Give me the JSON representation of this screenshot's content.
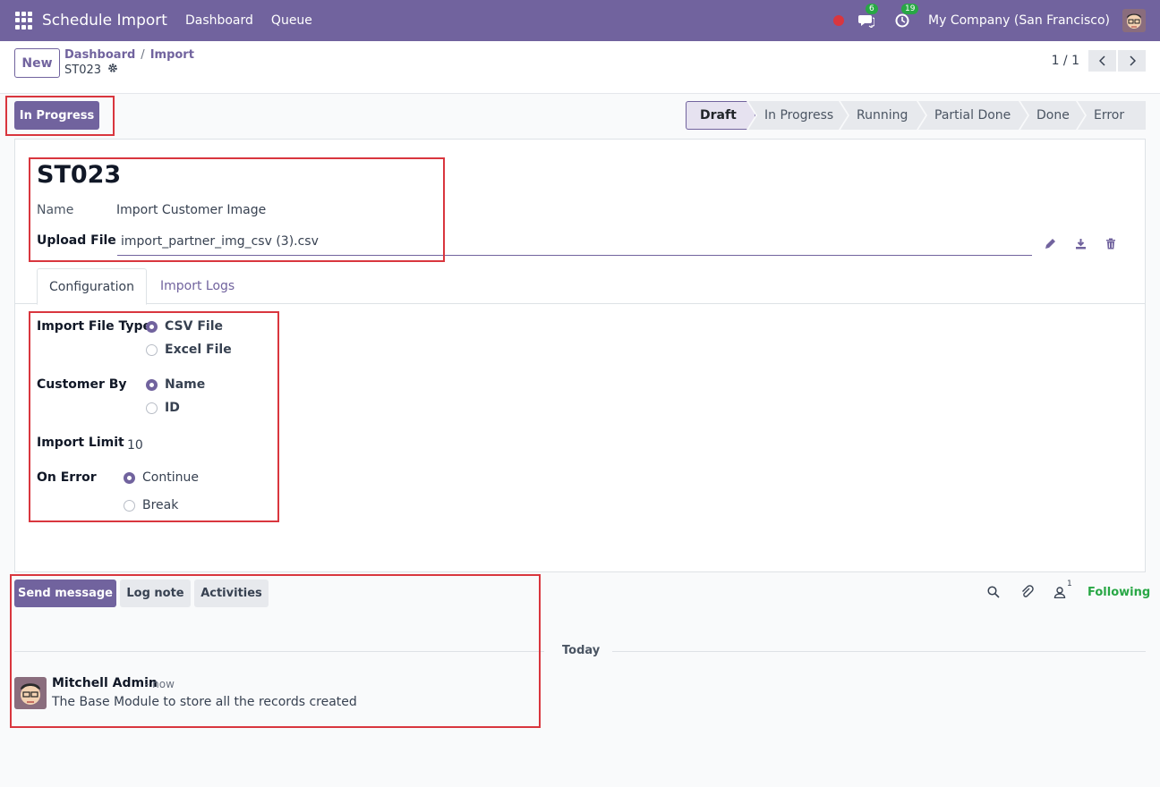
{
  "navbar": {
    "app_title": "Schedule Import",
    "menu": [
      "Dashboard",
      "Queue"
    ],
    "messages_count": "6",
    "activities_count": "19",
    "company": "My Company (San Francisco)"
  },
  "control": {
    "new_label": "New",
    "breadcrumbs": [
      "Dashboard",
      "Import"
    ],
    "breadcrumb_sep": "/",
    "record": "ST023",
    "pager": "1 / 1"
  },
  "status": {
    "action_button": "In Progress",
    "stages": [
      "Draft",
      "In Progress",
      "Running",
      "Partial Done",
      "Done",
      "Error"
    ],
    "current_stage": "Draft"
  },
  "form": {
    "title": "ST023",
    "name_label": "Name",
    "name_value": "Import Customer Image",
    "upload_label": "Upload File",
    "upload_value": "import_partner_img_csv (3).csv",
    "tabs": [
      "Configuration",
      "Import Logs"
    ],
    "import_file_type": {
      "label": "Import File Type",
      "options": [
        "CSV File",
        "Excel File"
      ],
      "selected": "CSV File"
    },
    "customer_by": {
      "label": "Customer By",
      "options": [
        "Name",
        "ID"
      ],
      "selected": "Name"
    },
    "import_limit": {
      "label": "Import Limit",
      "value": "10"
    },
    "on_error": {
      "label": "On Error",
      "options": [
        "Continue",
        "Break"
      ],
      "selected": "Continue"
    }
  },
  "chatter": {
    "send_message": "Send message",
    "log_note": "Log note",
    "activities": "Activities",
    "followers_count": "1",
    "following": "Following",
    "date_separator": "Today",
    "message": {
      "author": "Mitchell Admin",
      "time": "- now",
      "body": "The Base Module to store all the records created"
    }
  },
  "colors": {
    "brand": "#71639e",
    "success": "#28a745",
    "annotation": "#d9363e"
  }
}
